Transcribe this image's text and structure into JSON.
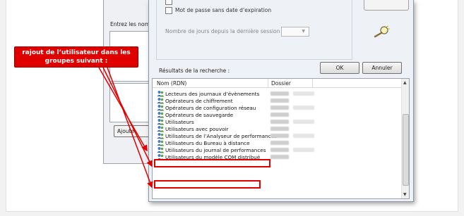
{
  "background_window": {
    "label": "Entrez les noms",
    "label_accel": "E",
    "button_label": "Ajoute"
  },
  "dialog": {
    "checkbox_top_label": "",
    "checkbox_no_expiry_label": "Mot de passe sans date d’expiration",
    "days_since_session_label": "Nombre de jours depuis la dernière session :",
    "days_select_value": "",
    "results_label": "Résultats de la recherche :",
    "ok_label": "OK",
    "cancel_label": "Annuler",
    "columns": [
      "Nom (RDN)",
      "Dossier"
    ],
    "rows": [
      {
        "name": "Lecteurs des journaux d’évènements",
        "highlighted": false
      },
      {
        "name": "Opérateurs de chiffrement",
        "highlighted": false
      },
      {
        "name": "Opérateurs de configuration réseau",
        "highlighted": false
      },
      {
        "name": "Opérateurs de sauvegarde",
        "highlighted": false
      },
      {
        "name": "Utilisateurs",
        "highlighted": false
      },
      {
        "name": "Utilisateurs avec pouvoir",
        "highlighted": false
      },
      {
        "name": "Utilisateurs de l’Analyseur de performances",
        "highlighted": true
      },
      {
        "name": "Utilisateurs du Bureau à distance",
        "highlighted": false
      },
      {
        "name": "Utilisateurs du journal de performances",
        "highlighted": false
      },
      {
        "name": "Utilisateurs du modèle COM distribué",
        "highlighted": true
      }
    ]
  },
  "annotation": {
    "text": "rajout de l’utilisateur dans les groupes suivant :",
    "color": "#e00000"
  },
  "icons": {
    "row_icon": "group-users-icon",
    "search_icon": "magnifier-icon"
  }
}
